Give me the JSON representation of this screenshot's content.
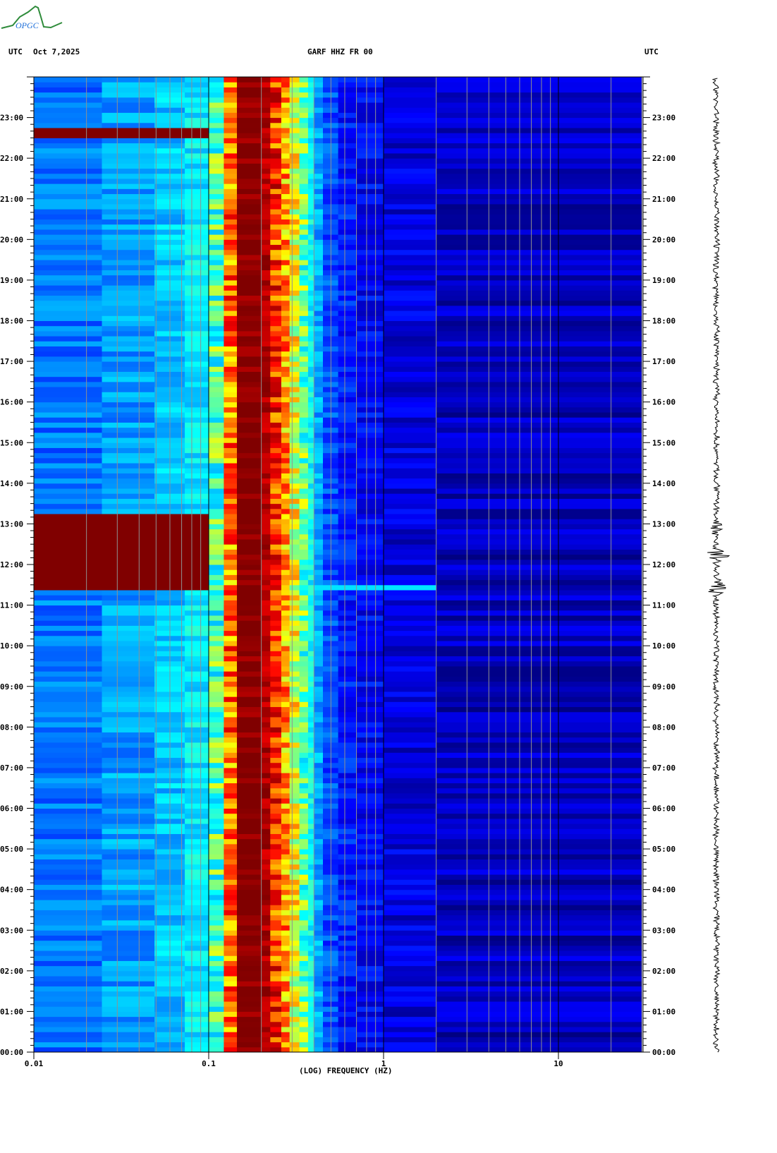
{
  "header": {
    "logo_text": "OPGC",
    "left_tz": "UTC",
    "date": "Oct 7,2025",
    "station": "GARF HHZ FR 00",
    "right_tz": "UTC"
  },
  "colors": {
    "grid_minor": "#909090",
    "grid_major": "#000000",
    "logo_green": "#2e8b3a",
    "logo_blue": "#1e6fd9"
  },
  "chart_data": {
    "type": "heatmap",
    "title": "GARF HHZ FR 00",
    "xlabel": "(LOG) FREQUENCY (HZ)",
    "ylabel": "UTC",
    "x_scale": "log",
    "xlim": [
      0.01,
      30
    ],
    "ylim_hours": [
      0,
      24
    ],
    "x_ticks": [
      {
        "value": 0.01,
        "label": "0.01"
      },
      {
        "value": 0.1,
        "label": "0.1"
      },
      {
        "value": 1,
        "label": "1"
      },
      {
        "value": 10,
        "label": "10"
      }
    ],
    "y_ticks": [
      "00:00",
      "01:00",
      "02:00",
      "03:00",
      "04:00",
      "05:00",
      "06:00",
      "07:00",
      "08:00",
      "09:00",
      "10:00",
      "11:00",
      "12:00",
      "13:00",
      "14:00",
      "15:00",
      "16:00",
      "17:00",
      "18:00",
      "19:00",
      "20:00",
      "21:00",
      "22:00",
      "23:00"
    ],
    "colormap": "jet",
    "frequency_bands": [
      {
        "f0": 0.01,
        "f1": 0.0245,
        "level": 0.24
      },
      {
        "f0": 0.0245,
        "f1": 0.049,
        "level": 0.28
      },
      {
        "f0": 0.049,
        "f1": 0.073,
        "level": 0.32
      },
      {
        "f0": 0.073,
        "f1": 0.1,
        "level": 0.36
      },
      {
        "f0": 0.1,
        "f1": 0.122,
        "level": 0.46
      },
      {
        "f0": 0.122,
        "f1": 0.145,
        "level": 0.76
      },
      {
        "f0": 0.145,
        "f1": 0.2,
        "level": 1.0
      },
      {
        "f0": 0.2,
        "f1": 0.225,
        "level": 0.95
      },
      {
        "f0": 0.225,
        "f1": 0.26,
        "level": 0.82
      },
      {
        "f0": 0.26,
        "f1": 0.29,
        "level": 0.72
      },
      {
        "f0": 0.29,
        "f1": 0.33,
        "level": 0.6
      },
      {
        "f0": 0.33,
        "f1": 0.37,
        "level": 0.48
      },
      {
        "f0": 0.37,
        "f1": 0.4,
        "level": 0.38
      },
      {
        "f0": 0.4,
        "f1": 0.45,
        "level": 0.29
      },
      {
        "f0": 0.45,
        "f1": 0.55,
        "level": 0.2
      },
      {
        "f0": 0.55,
        "f1": 0.7,
        "level": 0.15
      },
      {
        "f0": 0.7,
        "f1": 1.0,
        "level": 0.12
      },
      {
        "f0": 1.0,
        "f1": 2.0,
        "level": 0.09
      },
      {
        "f0": 2.0,
        "f1": 30,
        "level": 0.06
      }
    ],
    "events": [
      {
        "start_hour": 11.35,
        "end_hour": 13.3,
        "fmax": 0.1,
        "level": 1.0
      },
      {
        "start_hour": 22.5,
        "end_hour": 22.75,
        "fmax": 0.085,
        "level": 1.0
      },
      {
        "start_hour": 11.38,
        "end_hour": 11.45,
        "fmax": 2.0,
        "level": 0.5
      },
      {
        "start_hour": 22.88,
        "end_hour": 22.92,
        "fmax": 1.5,
        "level": 0.35
      }
    ],
    "seismogram_bursts": [
      {
        "hour": 11.45,
        "amplitude": 1.0
      },
      {
        "hour": 12.2,
        "amplitude": 0.9
      },
      {
        "hour": 12.9,
        "amplitude": 0.3
      }
    ]
  }
}
